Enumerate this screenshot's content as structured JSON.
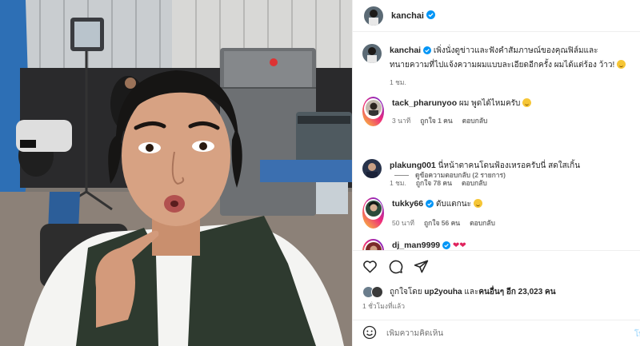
{
  "post": {
    "author": "kanchai",
    "photo_description_icon": "selfie-photo",
    "caption": {
      "username": "kanchai",
      "text": "เพิ่งนั่งดูข่าวและฟังคำสัมภาษณ์ของคุณฟิล์มและทนายความที่ไปแจ้งความผมแบบละเอียดอีกครั้ง ผมได้แต่ร้อง ว้าว!",
      "time": "1 ชม."
    }
  },
  "comments": [
    {
      "username": "tack_pharunyoo",
      "text": "ผม พูดได้ไหมครับ",
      "time": "3 นาที",
      "likes": "ถูกใจ 1 คน",
      "reply": "ตอบกลับ",
      "ring": true,
      "verified": false,
      "emoji": true
    },
    {
      "username": "plakung001",
      "text": "นี่หน้าตาคนโดนฟ้องเหรอครับนี่ สดใสเกิ้น",
      "time": "1 ชม.",
      "likes": "ถูกใจ 78 คน",
      "reply": "ตอบกลับ",
      "ring": false,
      "verified": false,
      "emoji": false
    },
    {
      "username": "tukky66",
      "text": "ตับแตกนะ",
      "time": "50 นาที",
      "likes": "ถูกใจ 56 คน",
      "reply": "ตอบกลับ",
      "ring": true,
      "verified": true,
      "emoji": true
    },
    {
      "username": "dj_man9999",
      "text": "",
      "ring": true,
      "verified": true
    }
  ],
  "view_replies": "ดูข้อความตอบกลับ (2 รายการ)",
  "actions": {
    "like_icon": "heart-icon",
    "comment_icon": "comment-icon",
    "share_icon": "share-icon"
  },
  "likes_summary": {
    "prefix": "ถูกใจโดย",
    "user": "up2youha",
    "middle": "และ",
    "others": "คนอื่นๆ อีก 23,023 คน"
  },
  "timestamp": "1 ชั่วโมงที่แล้ว",
  "add_comment": {
    "placeholder": "เพิ่มความคิดเห็น",
    "post_label": "โพ"
  },
  "colors": {
    "verified": "#0095f6",
    "text": "#262626",
    "muted": "#737373"
  }
}
